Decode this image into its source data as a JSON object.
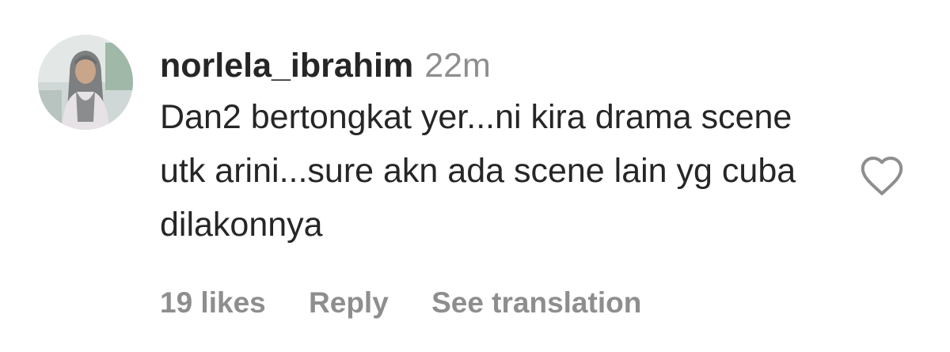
{
  "comment": {
    "username": "norlela_ibrahim",
    "timestamp": "22m",
    "text": "Dan2 bertongkat yer...ni kira drama scene utk arini...sure akn ada scene lain yg cuba dilakonnya",
    "likes": "19 likes",
    "reply_label": "Reply",
    "translate_label": "See translation",
    "like_icon": "heart-outline-icon",
    "avatar": "user-avatar"
  },
  "colors": {
    "text": "#262626",
    "muted": "#8e8e8e",
    "icon": "#8e8e8e",
    "background": "#ffffff"
  }
}
